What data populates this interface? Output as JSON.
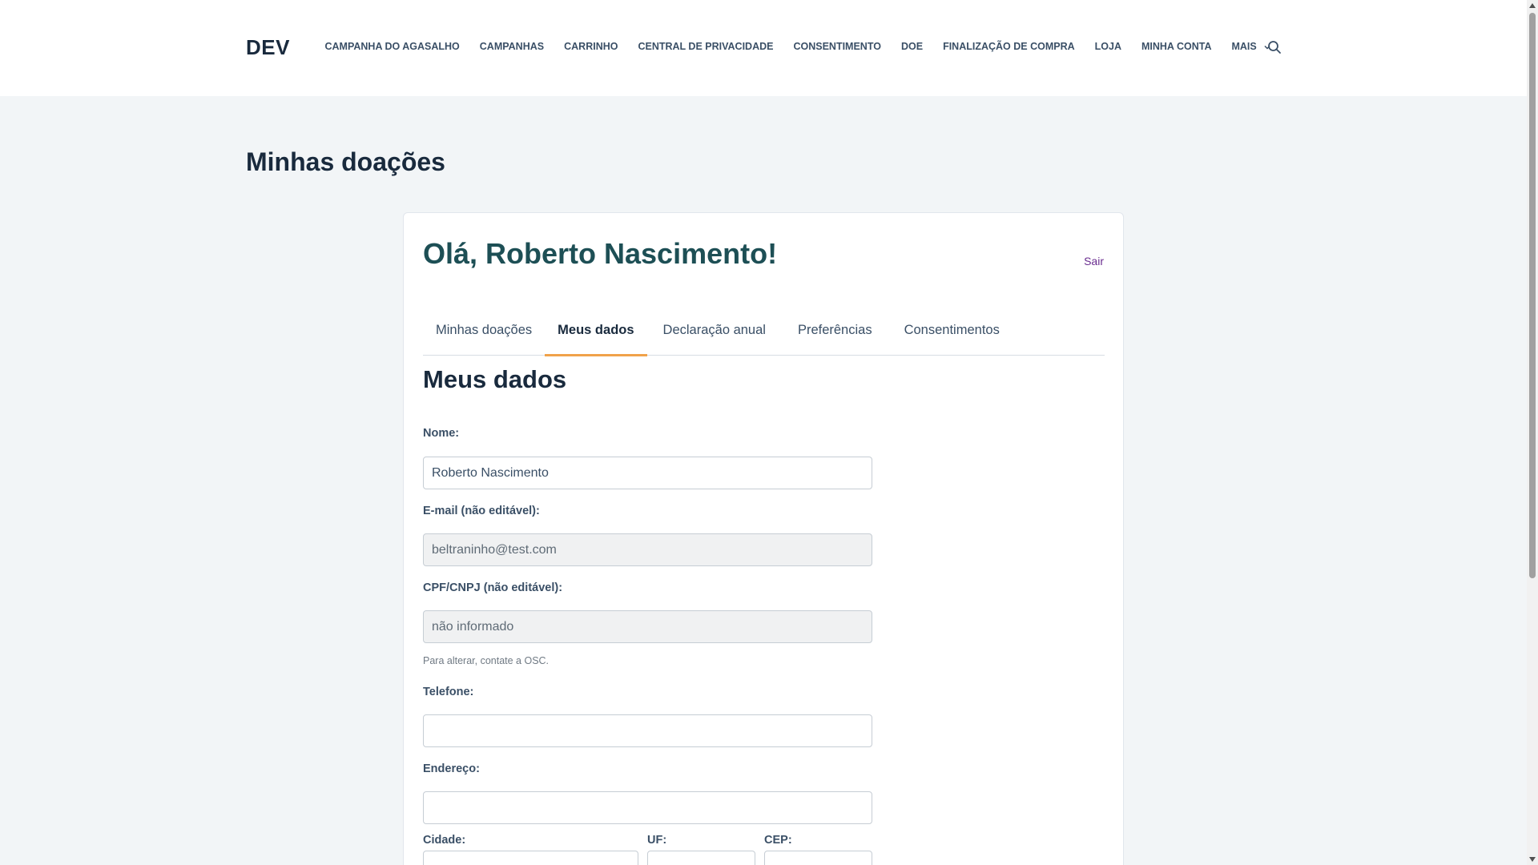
{
  "header": {
    "logo": "DEV",
    "nav": [
      "CAMPANHA DO AGASALHO",
      "CAMPANHAS",
      "CARRINHO",
      "CENTRAL DE PRIVACIDADE",
      "CONSENTIMENTO",
      "DOE",
      "FINALIZAÇÃO DE COMPRA",
      "LOJA",
      "MINHA CONTA",
      "MAIS"
    ]
  },
  "page": {
    "title": "Minhas doações"
  },
  "card": {
    "greeting": "Olá, Roberto Nascimento!",
    "logout": "Sair",
    "tabs": [
      "Minhas doações",
      "Meus dados",
      "Declaração anual",
      "Preferências",
      "Consentimentos"
    ],
    "active_tab": "Meus dados",
    "section_title": "Meus dados",
    "form": {
      "name_label": "Nome:",
      "name_value": "Roberto Nascimento",
      "email_label": "E-mail (não editável):",
      "email_value": "beltraninho@test.com",
      "cpf_label": "CPF/CNPJ (não editável):",
      "cpf_value": "não informado",
      "cpf_help": "Para alterar, contate a OSC.",
      "phone_label": "Telefone:",
      "phone_value": "",
      "address_label": "Endereço:",
      "address_value": "",
      "city_label": "Cidade:",
      "uf_label": "UF:",
      "cep_label": "CEP:"
    }
  },
  "colors": {
    "accent_tab_underline": "#f0a24a",
    "greeting": "#1d4f55",
    "logout_link": "#6a2d8f",
    "page_background": "#f2f5f7"
  }
}
